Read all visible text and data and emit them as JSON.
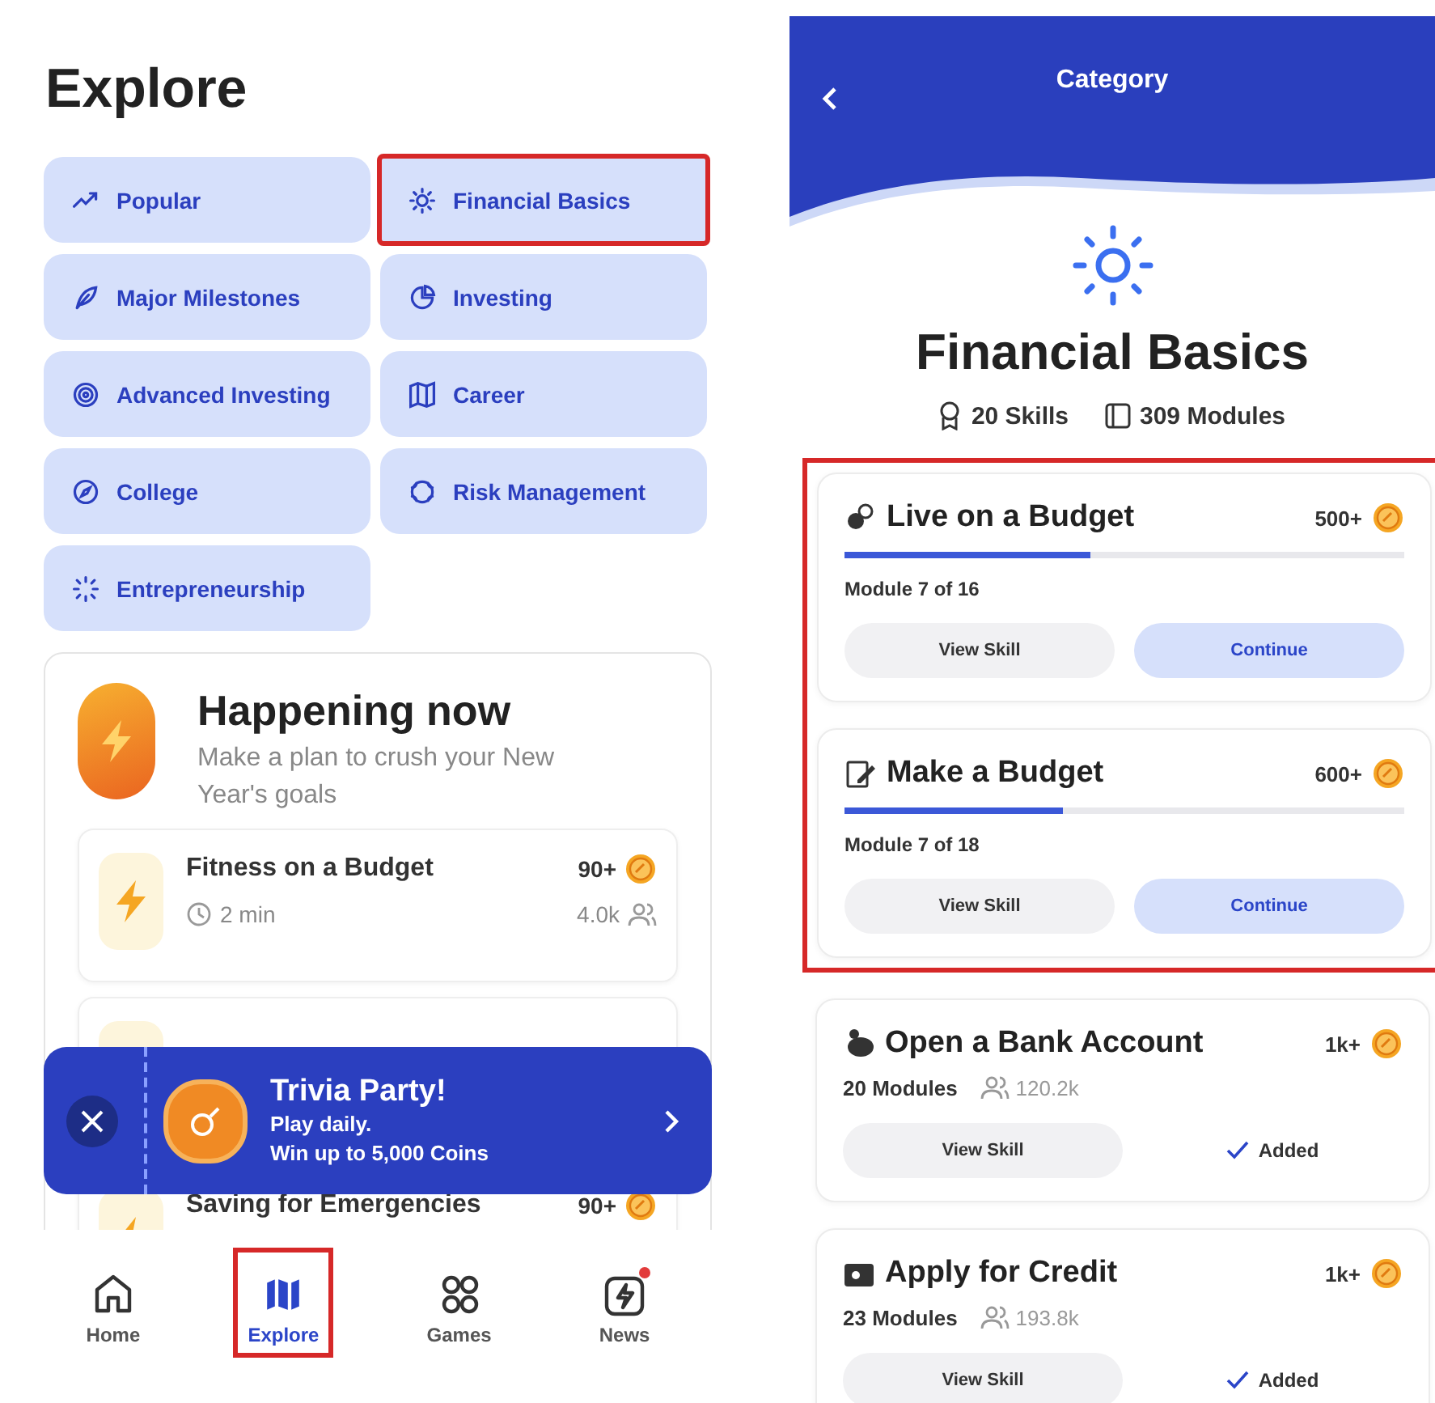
{
  "explore": {
    "title": "Explore",
    "categories": [
      {
        "label": "Popular",
        "highlighted": false
      },
      {
        "label": "Financial Basics",
        "highlighted": true
      },
      {
        "label": "Major Milestones",
        "highlighted": false
      },
      {
        "label": "Investing",
        "highlighted": false
      },
      {
        "label": "Advanced Investing",
        "highlighted": false
      },
      {
        "label": "Career",
        "highlighted": false
      },
      {
        "label": "College",
        "highlighted": false
      },
      {
        "label": "Risk Management",
        "highlighted": false
      },
      {
        "label": "Entrepreneurship",
        "highlighted": false
      }
    ],
    "happening": {
      "title": "Happening now",
      "subtitle": "Make a plan to crush your New Year's goals",
      "events": [
        {
          "title": "Fitness on a Budget",
          "coins": "90+",
          "duration": "2 min",
          "participants": "4.0k"
        },
        {
          "title": "Saving for Emergencies",
          "coins": "90+"
        }
      ]
    },
    "banner": {
      "title": "Trivia Party!",
      "line1": "Play daily.",
      "line2": "Win up to 5,000 Coins"
    },
    "nav": [
      {
        "label": "Home",
        "selected": false,
        "highlighted": false,
        "badge": false
      },
      {
        "label": "Explore",
        "selected": true,
        "highlighted": true,
        "badge": false
      },
      {
        "label": "Games",
        "selected": false,
        "highlighted": false,
        "badge": false
      },
      {
        "label": "News",
        "selected": false,
        "highlighted": false,
        "badge": true
      }
    ]
  },
  "category": {
    "header": {
      "title": "Category"
    },
    "title": "Financial Basics",
    "skills_count": "20 Skills",
    "modules_count": "309 Modules",
    "skills": [
      {
        "kind": "progress",
        "title": "Live on a Budget",
        "coins": "500+",
        "level": 0.44,
        "progress_text": "Module 7 of 16",
        "view": "View Skill",
        "action": "Continue",
        "highlighted": true
      },
      {
        "kind": "progress",
        "title": "Make a Budget",
        "coins": "600+",
        "level": 0.39,
        "progress_text": "Module 7 of 18",
        "view": "View Skill",
        "action": "Continue",
        "highlighted": true
      },
      {
        "kind": "added",
        "title": "Open a Bank Account",
        "coins": "1k+",
        "modules": "20 Modules",
        "learners": "120.2k",
        "view": "View Skill",
        "action": "Added",
        "highlighted": false
      },
      {
        "kind": "added",
        "title": "Apply for Credit",
        "coins": "1k+",
        "modules": "23 Modules",
        "learners": "193.8k",
        "view": "View Skill",
        "action": "Added",
        "highlighted": false
      }
    ]
  }
}
